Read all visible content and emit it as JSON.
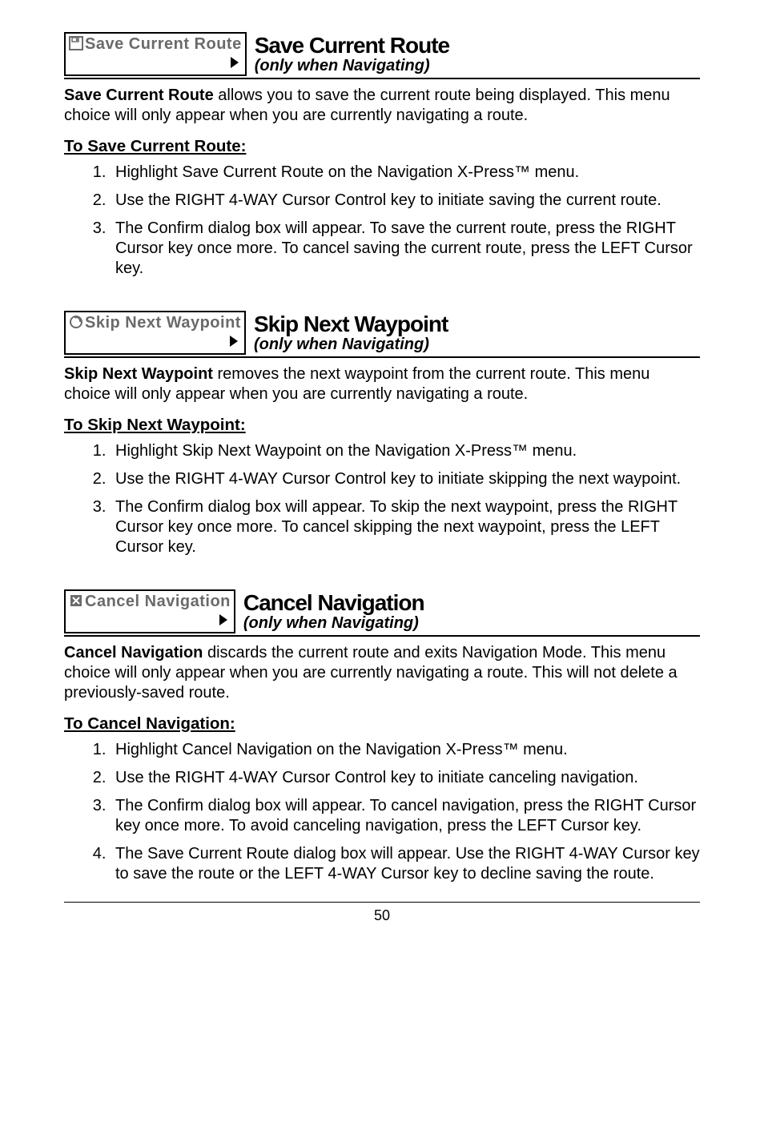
{
  "section1": {
    "menu_label": "Save Current Route",
    "title": "Save Current Route",
    "subtitle": "(only when Navigating)",
    "intro_bold": "Save Current Route",
    "intro_rest": " allows you to save the current route being displayed. This menu choice will only appear when you are currently navigating a route.",
    "howto": "To Save Current Route:",
    "steps": [
      "Highlight Save Current Route on the Navigation X-Press™ menu.",
      "Use the RIGHT 4-WAY Cursor Control key to initiate saving the current route.",
      "The Confirm dialog box will appear. To save the current route,  press the RIGHT Cursor key once more. To cancel saving the current route, press the LEFT Cursor key."
    ]
  },
  "section2": {
    "menu_label": "Skip Next Waypoint",
    "title": "Skip Next Waypoint",
    "subtitle": "(only when Navigating)",
    "intro_bold": "Skip Next Waypoint",
    "intro_rest": " removes the next waypoint from the current route. This menu choice will only appear when you are currently navigating a route.",
    "howto": "To Skip Next Waypoint:",
    "steps": [
      "Highlight Skip Next Waypoint on the Navigation X-Press™ menu.",
      "Use the RIGHT 4-WAY Cursor Control key to initiate skipping the next waypoint.",
      "The Confirm dialog box will appear. To skip the next waypoint,  press the RIGHT Cursor key once more. To cancel skipping the next waypoint, press the LEFT Cursor key."
    ]
  },
  "section3": {
    "menu_label": "Cancel Navigation",
    "title": "Cancel Navigation",
    "subtitle": "(only when Navigating)",
    "intro_bold": "Cancel Navigation",
    "intro_rest": " discards the current route and exits Navigation Mode. This menu choice will only appear when you are currently navigating a route. This will not delete a previously-saved route.",
    "howto": "To Cancel Navigation:",
    "steps": [
      "Highlight Cancel Navigation on the Navigation X-Press™ menu.",
      "Use the RIGHT 4-WAY Cursor Control key to initiate canceling navigation.",
      "The Confirm dialog box will appear. To cancel navigation,  press the RIGHT Cursor key once more. To avoid canceling navigation, press the LEFT Cursor key.",
      "The Save Current Route dialog box will appear.  Use the RIGHT 4-WAY Cursor key to save the route or the LEFT 4-WAY Cursor key to decline saving the route."
    ]
  },
  "page_number": "50"
}
